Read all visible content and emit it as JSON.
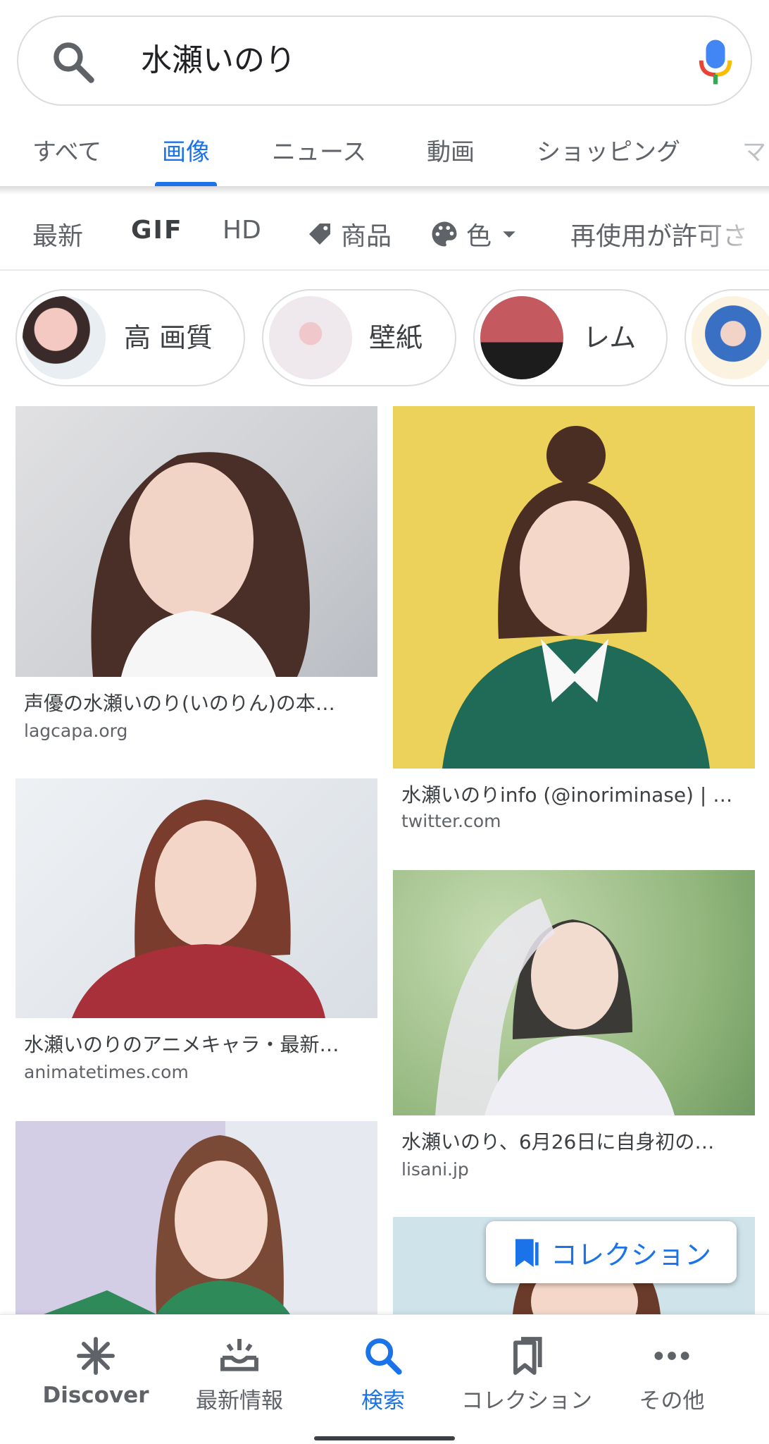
{
  "search": {
    "query": "水瀬いのり"
  },
  "tabs": [
    {
      "label": "すべて"
    },
    {
      "label": "画像"
    },
    {
      "label": "ニュース"
    },
    {
      "label": "動画"
    },
    {
      "label": "ショッピング"
    },
    {
      "label": "マ"
    }
  ],
  "active_tab": "画像",
  "filters": {
    "latest": "最新",
    "gif": "GIF",
    "hd": "HD",
    "products": "商品",
    "color": "色",
    "reuse": "再使用が許可さ"
  },
  "chips": [
    {
      "label": "高 画質",
      "icon": "thumbnail-photo"
    },
    {
      "label": "壁紙",
      "icon": "thumbnail-photo"
    },
    {
      "label": "レム",
      "icon": "thumbnail-photo"
    },
    {
      "label": "",
      "icon": "thumbnail-photo"
    }
  ],
  "results": [
    {
      "title": "声優の水瀬いのり(いのりん)の本…",
      "source": "lagcapa.org",
      "bg": "#d9d7d8"
    },
    {
      "title": "水瀬いのりinfo (@inoriminase) | …",
      "source": "twitter.com",
      "bg": "#ecd25a"
    },
    {
      "title": "水瀬いのりのアニメキャラ・最新…",
      "source": "animatetimes.com",
      "bg": "#e3e7eb"
    },
    {
      "title": "水瀬いのり、6月26日に自身初の…",
      "source": "lisani.jp",
      "bg": "#a9c98e"
    },
    {
      "title": "",
      "source": "",
      "bg": "#d7dbe9"
    },
    {
      "title": "",
      "source": "",
      "bg": "#cfe3ea"
    }
  ],
  "collection_button": {
    "label": "コレクション"
  },
  "bottom_nav": {
    "discover": "Discover",
    "updates": "最新情報",
    "search": "検索",
    "collections": "コレクション",
    "more": "その他"
  },
  "colors": {
    "accent": "#1a73e8",
    "text": "#3c4043",
    "muted": "#5f6368"
  }
}
